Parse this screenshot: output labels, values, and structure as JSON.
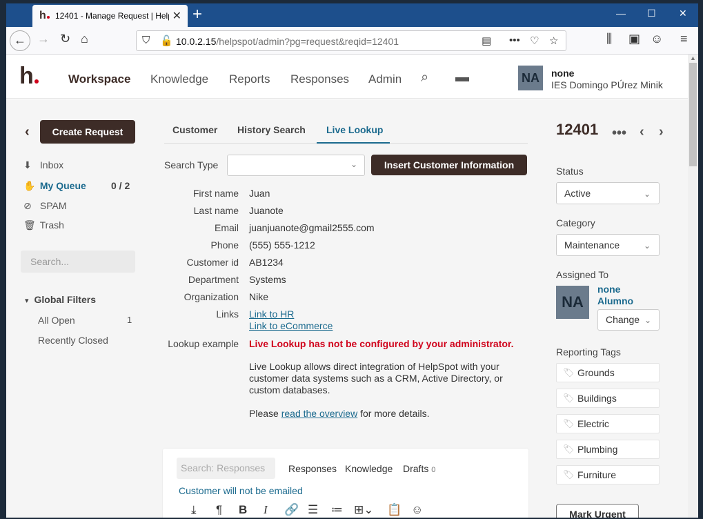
{
  "browser": {
    "tab_title": "12401 - Manage Request | HelpSpot",
    "tab_favicon": "h",
    "new_tab": "+",
    "url_host": "10.0.2.15",
    "url_path": "/helpspot/admin?pg=request&reqid=12401"
  },
  "header": {
    "logo": "h",
    "nav": [
      "Workspace",
      "Knowledge",
      "Reports",
      "Responses",
      "Admin"
    ],
    "active_nav": "Workspace",
    "avatar_initials": "NA",
    "user_name": "none",
    "org_name": "IES Domingo PÚrez Minik"
  },
  "left": {
    "create_label": "Create Request",
    "queues": [
      {
        "label": "Inbox",
        "icon": "inbox-icon",
        "glyph": "⬇"
      },
      {
        "label": "My Queue",
        "icon": "hand-icon",
        "glyph": "✋"
      },
      {
        "label": "SPAM",
        "icon": "spam-icon",
        "glyph": "⊘"
      },
      {
        "label": "Trash",
        "icon": "trash-icon",
        "glyph": "🗑"
      }
    ],
    "my_queue_count": "0 / 2",
    "search_placeholder": "Search...",
    "global_filters_title": "Global Filters",
    "filters": [
      {
        "label": "All Open",
        "count": "1"
      },
      {
        "label": "Recently Closed",
        "count": ""
      }
    ]
  },
  "middle": {
    "tabs": [
      "Customer",
      "History Search",
      "Live Lookup"
    ],
    "active_tab": "Live Lookup",
    "search_type_label": "Search Type",
    "search_type_value": "",
    "insert_label": "Insert Customer Information",
    "fields": [
      {
        "label": "First name",
        "value": "Juan"
      },
      {
        "label": "Last name",
        "value": "Juanote"
      },
      {
        "label": "Email",
        "value": "juanjuanote@gmail2555.com"
      },
      {
        "label": "Phone",
        "value": "(555) 555-1212"
      },
      {
        "label": "Customer id",
        "value": "AB1234"
      },
      {
        "label": "Department",
        "value": "Systems"
      },
      {
        "label": "Organization",
        "value": "Nike"
      }
    ],
    "links_label": "Links",
    "links": [
      "Link to HR",
      "Link to eCommerce"
    ],
    "lookup_label": "Lookup example",
    "lookup_error": "Live Lookup has not be configured by your administrator.",
    "lookup_desc": "Live Lookup allows direct integration of HelpSpot with your customer data systems such as a CRM, Active Directory, or custom databases.",
    "more_prefix": "Please ",
    "more_link": "read the overview",
    "more_suffix": " for more details."
  },
  "composer": {
    "search_placeholder": "Search: Responses",
    "tabs": [
      "Responses",
      "Knowledge",
      "Drafts"
    ],
    "drafts_count": "0",
    "note": "Customer will not be emailed",
    "tools": [
      "download-icon",
      "paragraph-icon",
      "bold-icon",
      "italic-icon",
      "link-icon",
      "bullet-list-icon",
      "numbered-list-icon",
      "table-icon",
      "paste-icon",
      "emoji-icon"
    ]
  },
  "right": {
    "request_id": "12401",
    "status_label": "Status",
    "status_value": "Active",
    "category_label": "Category",
    "category_value": "Maintenance",
    "assigned_label": "Assigned To",
    "assignee_initials": "NA",
    "assignee_first": "none",
    "assignee_last": "Alumno",
    "change_label": "Change",
    "tags_label": "Reporting Tags",
    "tags": [
      "Grounds",
      "Buildings",
      "Electric",
      "Plumbing",
      "Furniture"
    ],
    "urgent_label": "Mark Urgent"
  }
}
